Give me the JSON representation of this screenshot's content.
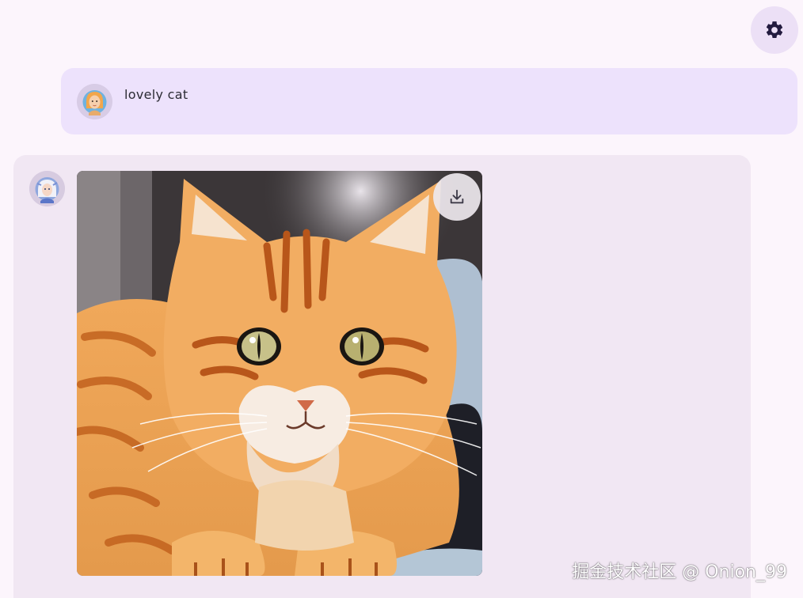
{
  "settings": {
    "icon": "gear-icon"
  },
  "conversation": {
    "user_message": {
      "avatar": "user-avatar",
      "text": "lovely cat"
    },
    "bot_message": {
      "avatar": "bot-avatar",
      "image": "orange-tabby-cat-image",
      "download_icon": "download-icon"
    }
  },
  "watermark": {
    "text": "掘金技术社区 @ Onion_99"
  },
  "colors": {
    "background": "#fcf5fc",
    "user_bubble": "#ede2fc",
    "bot_bubble": "#f1e7f3",
    "icon": "#231b3f"
  }
}
